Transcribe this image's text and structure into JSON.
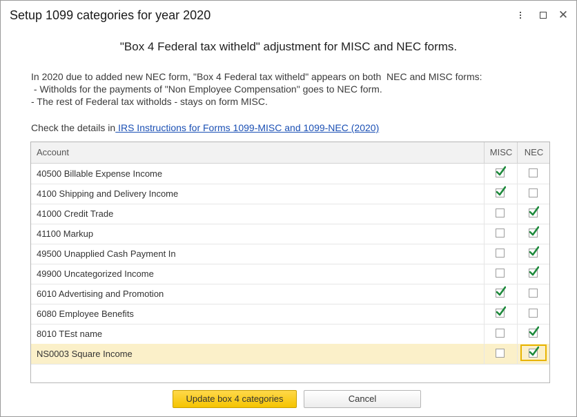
{
  "window": {
    "title": "Setup 1099 categories for year 2020"
  },
  "heading": "\"Box 4 Federal tax witheld\" adjustment for MISC and NEC forms.",
  "description": [
    "In 2020 due to added new NEC form, \"Box 4 Federal tax witheld\" appears on both  NEC and MISC forms:",
    " - Witholds for the payments of \"Non Employee Compensation\" goes to NEC form.",
    "- The rest of Federal tax witholds - stays on form MISC."
  ],
  "details": {
    "prefix": "Check the details in",
    "link_text": " IRS Instructions for Forms 1099-MISC and 1099-NEC (2020)"
  },
  "table": {
    "headers": {
      "account": "Account",
      "misc": "MISC",
      "nec": "NEC"
    },
    "rows": [
      {
        "account": "40500 Billable Expense Income",
        "misc": true,
        "nec": false
      },
      {
        "account": "4100 Shipping and Delivery Income",
        "misc": true,
        "nec": false
      },
      {
        "account": "41000 Credit Trade",
        "misc": false,
        "nec": true
      },
      {
        "account": "41100 Markup",
        "misc": false,
        "nec": true
      },
      {
        "account": "49500 Unapplied Cash Payment In",
        "misc": false,
        "nec": true
      },
      {
        "account": "49900 Uncategorized Income",
        "misc": false,
        "nec": true
      },
      {
        "account": "6010 Advertising and Promotion",
        "misc": true,
        "nec": false
      },
      {
        "account": "6080 Employee Benefits",
        "misc": true,
        "nec": false
      },
      {
        "account": "8010 TEst name",
        "misc": false,
        "nec": true
      },
      {
        "account": "NS0003 Square Income",
        "misc": false,
        "nec": true
      }
    ],
    "selected_row": 9
  },
  "buttons": {
    "update": "Update box 4 categories",
    "cancel": "Cancel"
  },
  "colors": {
    "accent": "#f5c400",
    "check": "#1e8a3c",
    "selected_row": "#fbf0c9"
  }
}
